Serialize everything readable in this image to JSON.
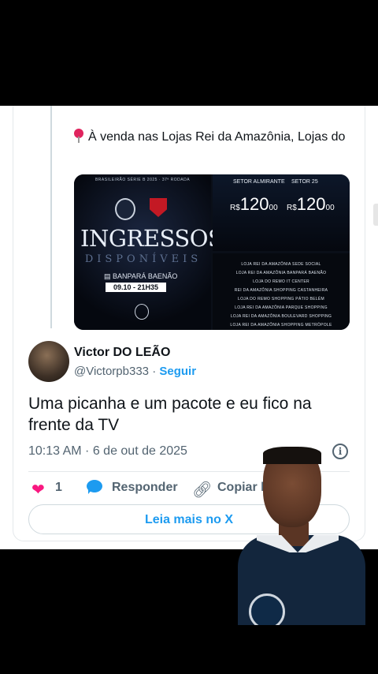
{
  "quoted": {
    "cut_text": "",
    "text": "À venda nas Lojas Rei da Amazônia, Lojas do",
    "pin_icon": "round-pushpin-icon",
    "poster_left": {
      "header": "BRASILEIRÃO SÉRIE B 2025 · 37ª RODADA",
      "title": "INGRESSOS",
      "subtitle": "DISPONÍVEIS",
      "venue": "BANPARÁ BAENÃO",
      "date_time": "09.10 - 21H35"
    },
    "poster_right": {
      "sectors": [
        {
          "name": "SETOR ALMIRANTE",
          "price_prefix": "R$",
          "price": "120",
          "cents": "00"
        },
        {
          "name": "SETOR 25",
          "price_prefix": "R$",
          "price": "120",
          "cents": "00"
        }
      ],
      "stores": [
        "LOJA REI DA AMAZÔNIA SEDE SOCIAL",
        "LOJA REI DA AMAZÔNIA BANPARÁ BAENÃO",
        "LOJA DO REMO IT CENTER",
        "REI DA AMAZÔNIA SHOPPING CASTANHEIRA",
        "LOJA DO REMO SHOPPING PÁTIO BELÉM",
        "LOJA REI DA AMAZÔNIA PARQUE SHOPPING",
        "LOJA REI DA AMAZÔNIA BOULEVARD SHOPPING",
        "LOJA REI DA AMAZÔNIA SHOPPING METRÓPOLE"
      ]
    }
  },
  "author": {
    "name": "Victor DO LEÃO",
    "handle": "@Victorpb333",
    "separator": "·",
    "follow_label": "Seguir"
  },
  "tweet": {
    "text": "Uma picanha e um pacote e eu fico na frente da TV",
    "timestamp": "10:13 AM · 6 de out de 2025"
  },
  "actions": {
    "like_count": "1",
    "reply_label": "Responder",
    "copy_label": "Copiar li"
  },
  "read_more_label": "Leia mais no X",
  "colors": {
    "accent": "#1d9bf0",
    "like": "#f91880",
    "text": "#0f1419",
    "muted": "#536471"
  }
}
